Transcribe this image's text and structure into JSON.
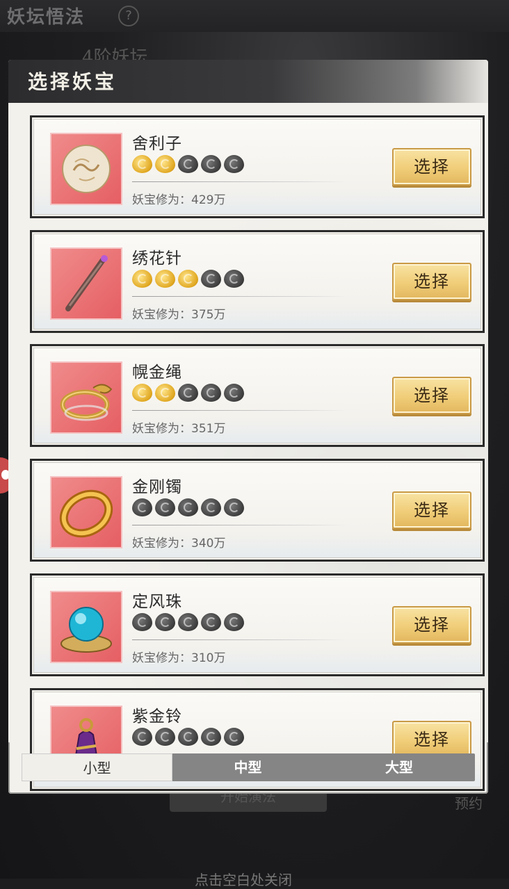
{
  "background": {
    "title": "妖坛悟法",
    "help_icon": "question-icon",
    "subtitle": "4阶妖坛",
    "bottom_button": "开始演法",
    "right_text": "预约",
    "close_hint": "点击空白处关闭"
  },
  "panel": {
    "title": "选择妖宝",
    "items": [
      {
        "name": "舍利子",
        "stars_on": 2,
        "stars_total": 5,
        "cultivation": "妖宝修为：429万",
        "button": "选择",
        "icon": "sarira-pearl-icon"
      },
      {
        "name": "绣花针",
        "stars_on": 3,
        "stars_total": 5,
        "cultivation": "妖宝修为：375万",
        "button": "选择",
        "icon": "embroidery-needle-icon"
      },
      {
        "name": "幌金绳",
        "stars_on": 2,
        "stars_total": 5,
        "cultivation": "妖宝修为：351万",
        "button": "选择",
        "icon": "golden-rope-icon"
      },
      {
        "name": "金刚镯",
        "stars_on": 0,
        "stars_total": 5,
        "cultivation": "妖宝修为：340万",
        "button": "选择",
        "icon": "diamond-bracelet-icon"
      },
      {
        "name": "定风珠",
        "stars_on": 0,
        "stars_total": 5,
        "cultivation": "妖宝修为：310万",
        "button": "选择",
        "icon": "wind-pearl-icon"
      },
      {
        "name": "紫金铃",
        "stars_on": 0,
        "stars_total": 5,
        "cultivation": "",
        "button": "选择",
        "icon": "purple-gold-bell-icon"
      }
    ],
    "tabs": [
      "小型",
      "中型",
      "大型"
    ],
    "active_tab": 0
  },
  "colors": {
    "star_on": "#e0a720",
    "star_off": "#3d3d3d",
    "icon_bg": "#e55f63",
    "button_gold": "#f0cd78"
  }
}
